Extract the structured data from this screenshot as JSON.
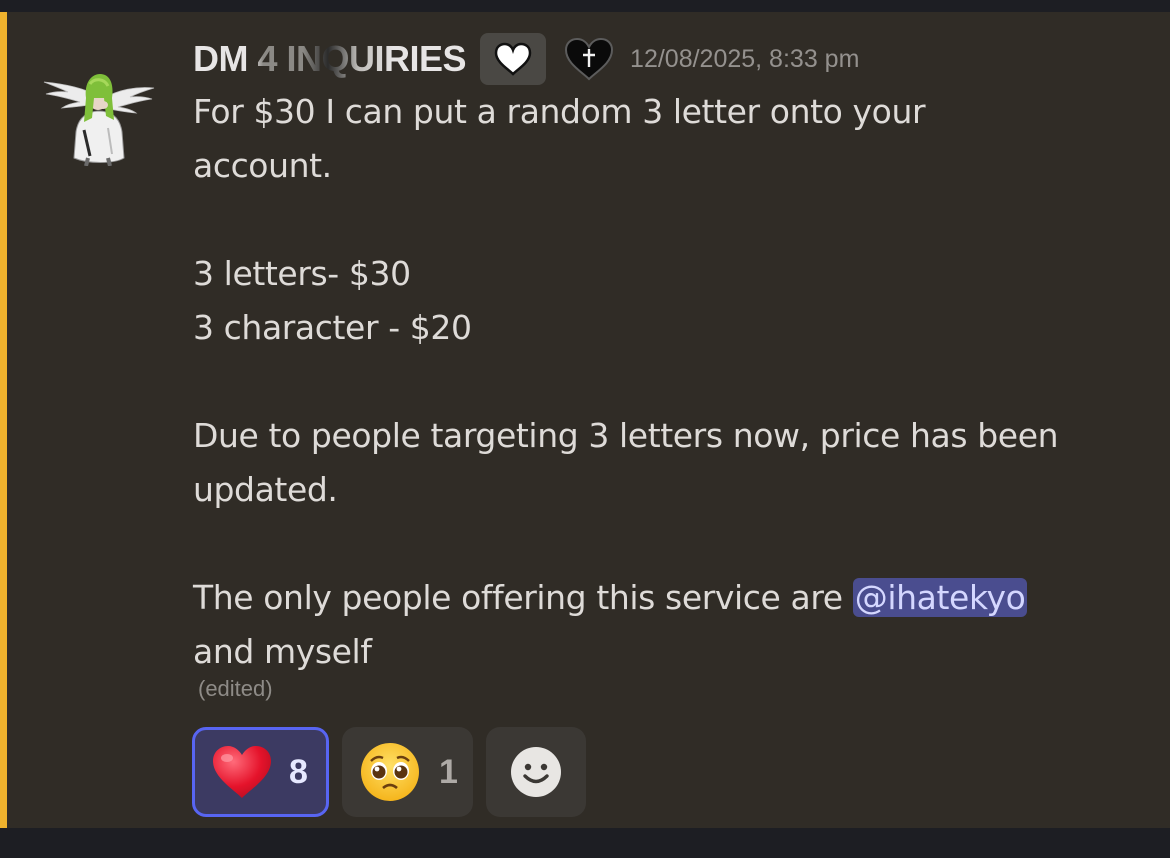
{
  "message": {
    "author": "DM 4 INQUIRIES",
    "timestamp": "12/08/2025, 8:33 pm",
    "badges": [
      "white-heart-icon",
      "black-heart-cross-icon"
    ],
    "lines": [
      "For $30 I can put a random 3 letter onto your",
      "account.",
      "3 letters- $30",
      "3 character - $20",
      "Due to people targeting 3 letters now, price has been",
      "updated.",
      "The only people offering this service are",
      "and myself"
    ],
    "mention": "@ihatekyo",
    "edited_label": "(edited)"
  },
  "reactions": [
    {
      "emoji": "heart-emoji",
      "count": "8",
      "active": true
    },
    {
      "emoji": "pleading-face-emoji",
      "count": "1",
      "active": false
    },
    {
      "emoji": "add-reaction-icon",
      "count": "",
      "active": false
    }
  ],
  "colors": {
    "highlight_bar": "#efb22d",
    "mention_bg": "#4a4d8f",
    "active_reaction_border": "#5865f2",
    "message_bg": "#302c26"
  }
}
